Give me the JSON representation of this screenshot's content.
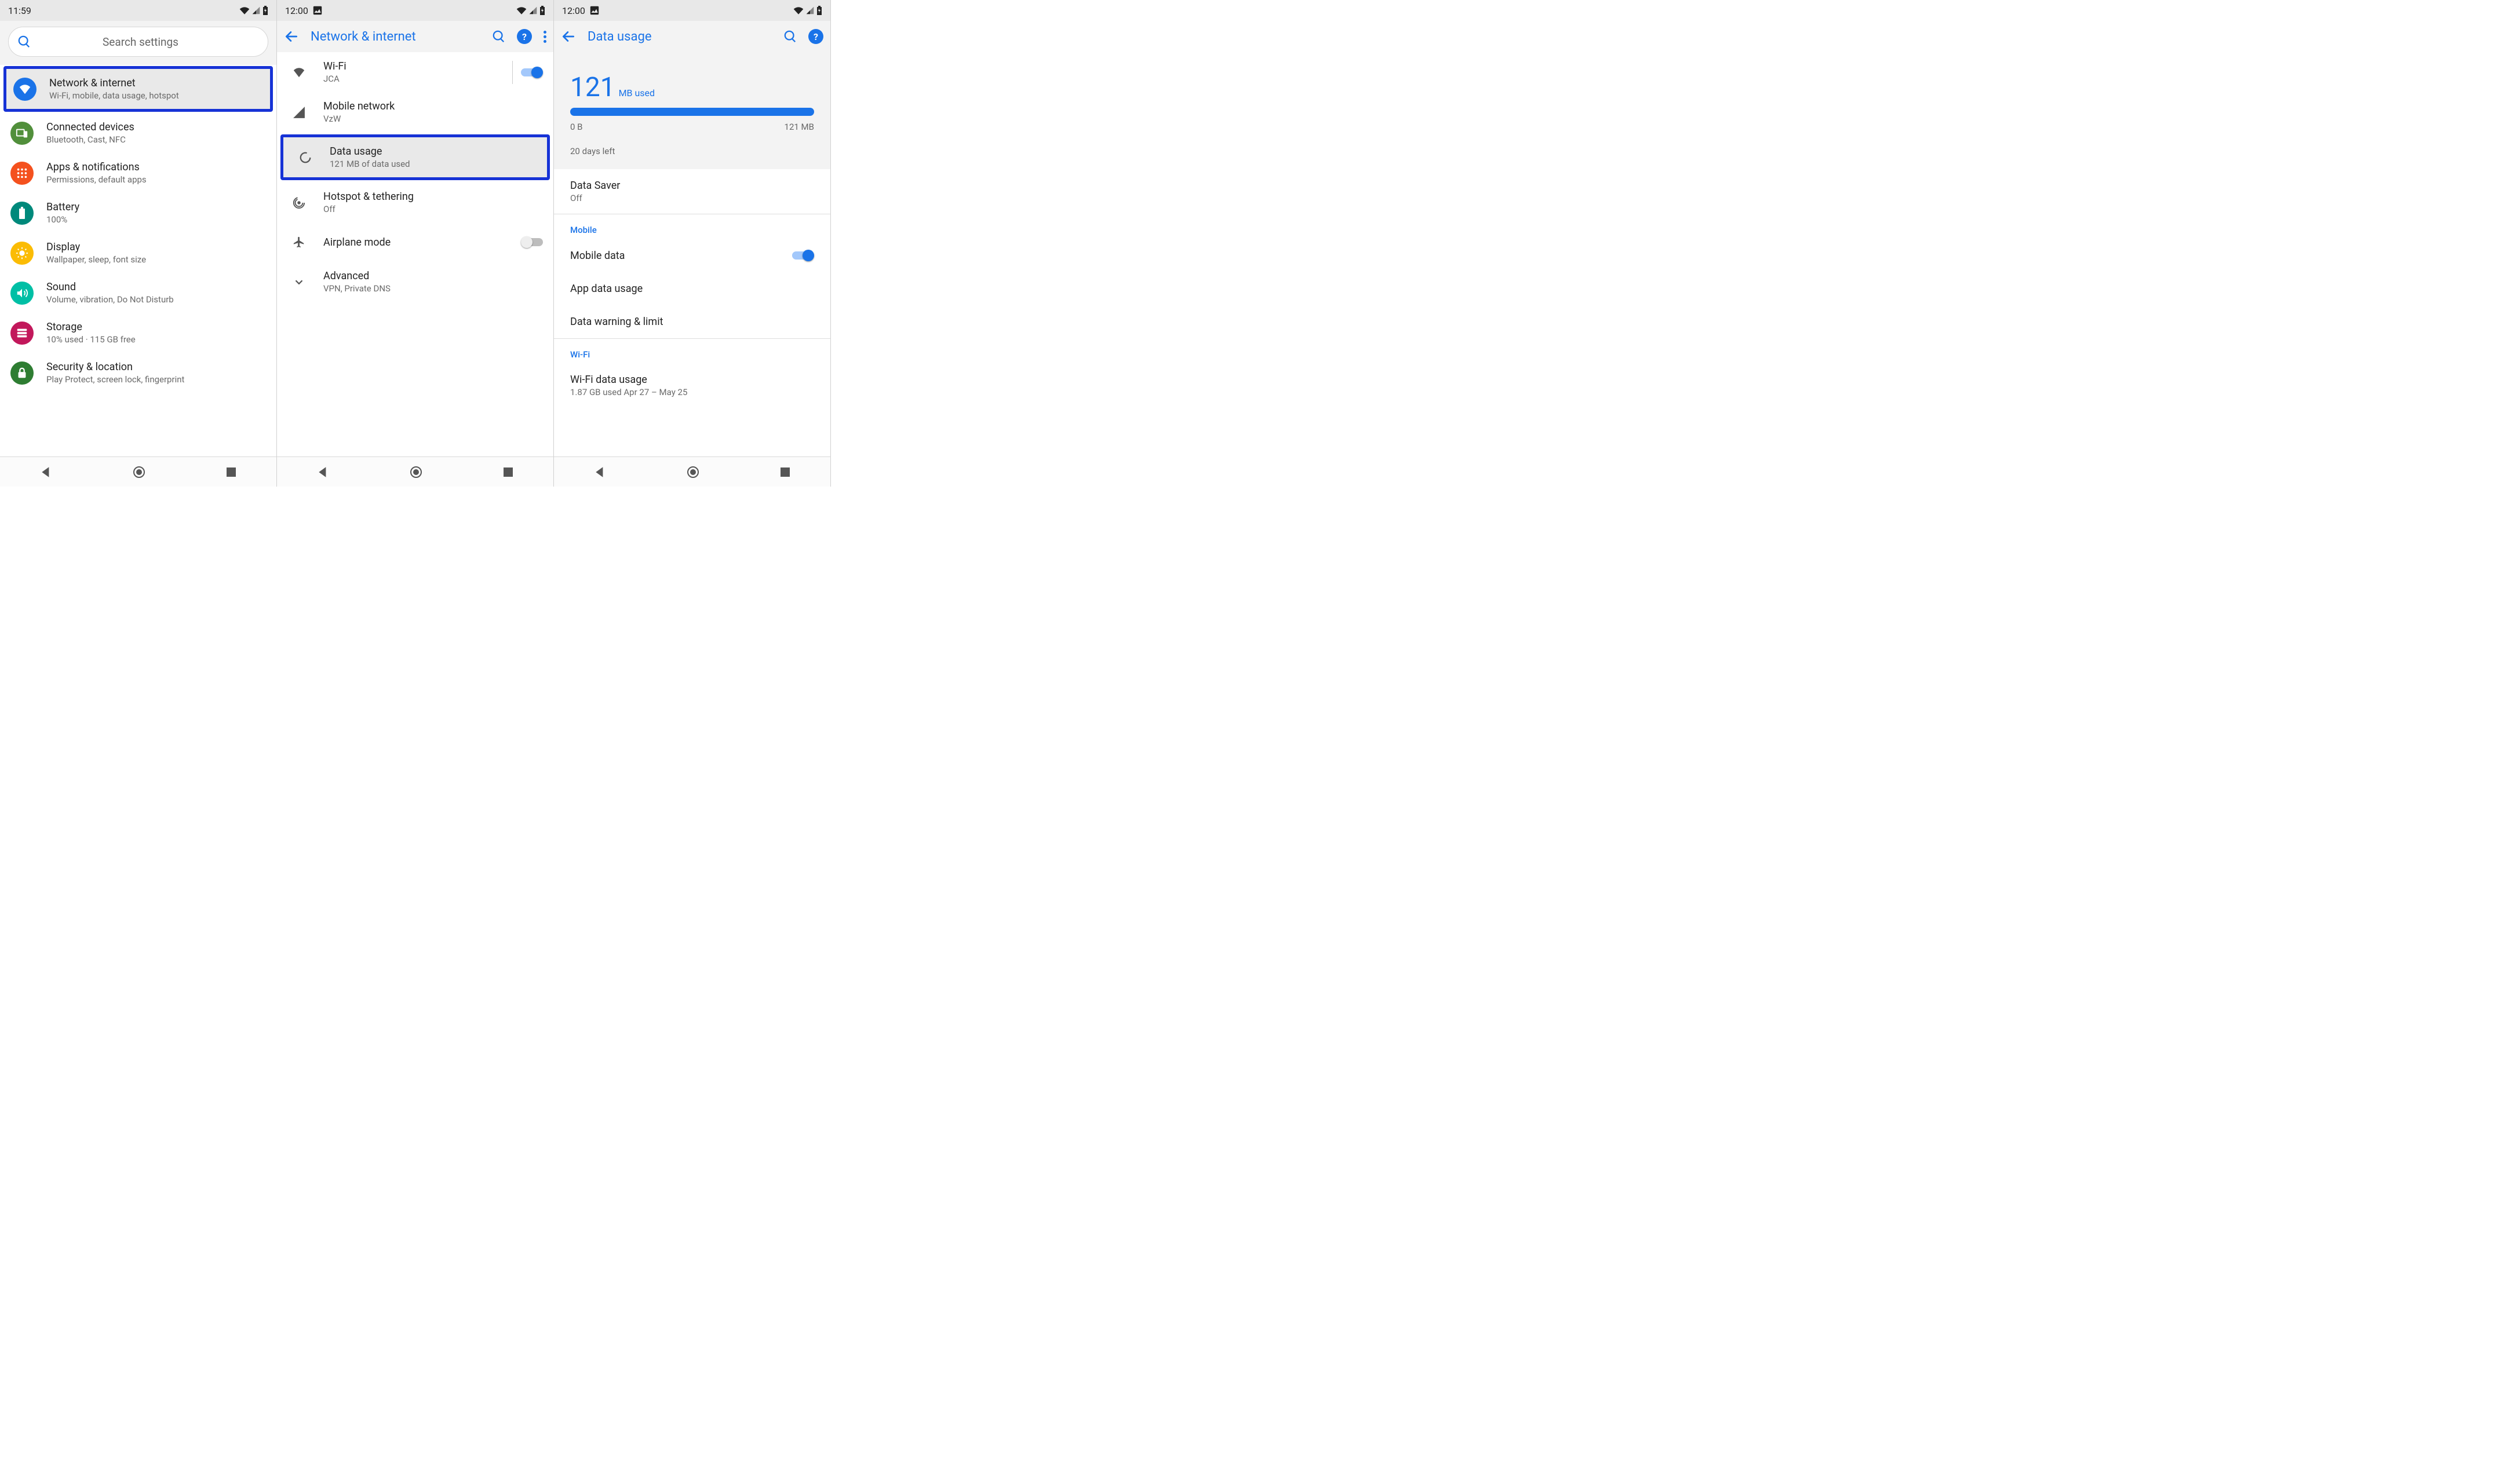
{
  "status": {
    "time1": "11:59",
    "time2": "12:00",
    "time3": "12:00"
  },
  "screen1": {
    "search_placeholder": "Search settings",
    "items": [
      {
        "title": "Network & internet",
        "sub": "Wi-Fi, mobile, data usage, hotspot",
        "color": "#1a73e8",
        "icon": "wifi-fan",
        "highlighted": true
      },
      {
        "title": "Connected devices",
        "sub": "Bluetooth, Cast, NFC",
        "color": "#518f3b",
        "icon": "devices"
      },
      {
        "title": "Apps & notifications",
        "sub": "Permissions, default apps",
        "color": "#f4511e",
        "icon": "apps"
      },
      {
        "title": "Battery",
        "sub": "100%",
        "color": "#00897b",
        "icon": "battery"
      },
      {
        "title": "Display",
        "sub": "Wallpaper, sleep, font size",
        "color": "#fbbc04",
        "icon": "brightness"
      },
      {
        "title": "Sound",
        "sub": "Volume, vibration, Do Not Disturb",
        "color": "#00bfa5",
        "icon": "sound"
      },
      {
        "title": "Storage",
        "sub": "10% used · 115 GB free",
        "color": "#c2185b",
        "icon": "storage"
      },
      {
        "title": "Security & location",
        "sub": "Play Protect, screen lock, fingerprint",
        "color": "#2e7d32",
        "icon": "lock"
      }
    ]
  },
  "screen2": {
    "title": "Network & internet",
    "items": [
      {
        "title": "Wi-Fi",
        "sub": "JCA",
        "icon": "wifi-fan",
        "toggle": "on",
        "divider": true
      },
      {
        "title": "Mobile network",
        "sub": "VzW",
        "icon": "signal"
      },
      {
        "title": "Data usage",
        "sub": "121 MB of data used",
        "icon": "datacircle",
        "highlighted": true
      },
      {
        "title": "Hotspot & tethering",
        "sub": "Off",
        "icon": "hotspot"
      },
      {
        "title": "Airplane mode",
        "sub": "",
        "icon": "airplane",
        "toggle": "off"
      },
      {
        "title": "Advanced",
        "sub": "VPN, Private DNS",
        "icon": "chevron"
      }
    ]
  },
  "screen3": {
    "title": "Data usage",
    "usage_num": "121",
    "usage_unit": "MB used",
    "bar_min": "0 B",
    "bar_max": "121 MB",
    "days_left": "20 days left",
    "data_saver_title": "Data Saver",
    "data_saver_sub": "Off",
    "section_mobile": "Mobile",
    "mobile_data_label": "Mobile data",
    "app_data_usage": "App data usage",
    "data_warning": "Data warning & limit",
    "section_wifi": "Wi-Fi",
    "wifi_usage_title": "Wi-Fi data usage",
    "wifi_usage_sub": "1.87 GB used Apr 27 – May 25"
  }
}
